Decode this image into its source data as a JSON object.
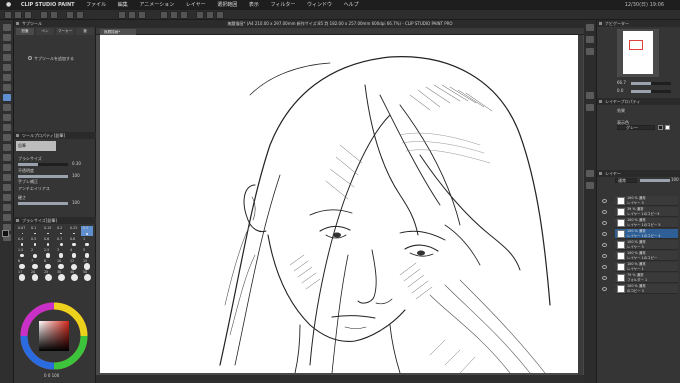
{
  "menubar": {
    "app": "CLIP STUDIO PAINT",
    "items": [
      "ファイル",
      "編集",
      "アニメーション",
      "レイヤー",
      "選択範囲",
      "表示",
      "フィルター",
      "ウィンドウ",
      "ヘルプ"
    ],
    "clock": "12/30(日) 19:06"
  },
  "document": {
    "title": "無題描画* (A4 210.00 x 297.00mm 新作サイズ:85 判 182.00 x 257.00mm 600dpi 66.7%) - CLIP STUDIO PAINT PRO",
    "tab": "無題描画*"
  },
  "subtool": {
    "header": "サブツール",
    "tabs": [
      "鉛筆",
      "ペン",
      "マーカー",
      "筆"
    ],
    "add_hint": "サブツールを追加する"
  },
  "tool_property": {
    "header": "ツールプロパティ[鉛筆]",
    "preset": "鉛筆",
    "brush_size_label": "ブラシサイズ",
    "brush_size": "0.30",
    "opacity_label": "不透明度",
    "opacity": "100",
    "stabilization_label": "手ブレ補正",
    "stabilization": "",
    "aa_label": "アンチエイリアス",
    "hardness_label": "硬さ",
    "hardness": "100"
  },
  "brush_size_panel": {
    "header": "ブラシサイズ[鉛筆]",
    "sizes": [
      "0.07",
      "0.1",
      "0.15",
      "0.2",
      "0.25",
      "0.3",
      "0.4",
      "0.5",
      "0.6",
      "0.7",
      "0.8",
      "1",
      "1.5",
      "2",
      "2.5",
      "3",
      "4",
      "5",
      "6",
      "7",
      "8",
      "10",
      "12",
      "15",
      "17",
      "20",
      "25",
      "30",
      "40",
      "50"
    ],
    "selected": "0.3"
  },
  "color_wheel": {
    "readout": "0 0 100"
  },
  "navigator": {
    "header": "ナビゲーター",
    "zoom": "66.7",
    "rotate": "0.0"
  },
  "layer_property": {
    "header": "レイヤープロパティ",
    "effect_label": "効果",
    "display_color_label": "表示色",
    "display_color_value": "グレー"
  },
  "layer_panel": {
    "header": "レイヤー",
    "blend": "通常",
    "opacity": "100",
    "layers": [
      {
        "opacity": "100 % 通常",
        "name": "レイヤー 3",
        "selected": false
      },
      {
        "opacity": "39 % 通常",
        "name": "レイヤー 1のコピー3",
        "selected": false
      },
      {
        "opacity": "100 % 通常",
        "name": "レイヤー 1のコピー 5",
        "selected": false
      },
      {
        "opacity": "100 % 通常",
        "name": "レイヤー 1のコピー 4",
        "selected": true
      },
      {
        "opacity": "100 % 通常",
        "name": "レイヤー 3",
        "selected": false
      },
      {
        "opacity": "100 % 通常",
        "name": "レイヤー 1のコピー",
        "selected": false
      },
      {
        "opacity": "100 % 通常",
        "name": "レイヤー 1",
        "selected": false
      },
      {
        "opacity": "79 % 通常",
        "name": "フォルダー 1",
        "selected": false
      },
      {
        "opacity": "100 % 通常",
        "name": "のコピー 3",
        "selected": false
      }
    ]
  },
  "colors": {
    "accent": "#2f5f97",
    "main_color": "#1a1a1a",
    "sub_color": "#ffffff"
  }
}
